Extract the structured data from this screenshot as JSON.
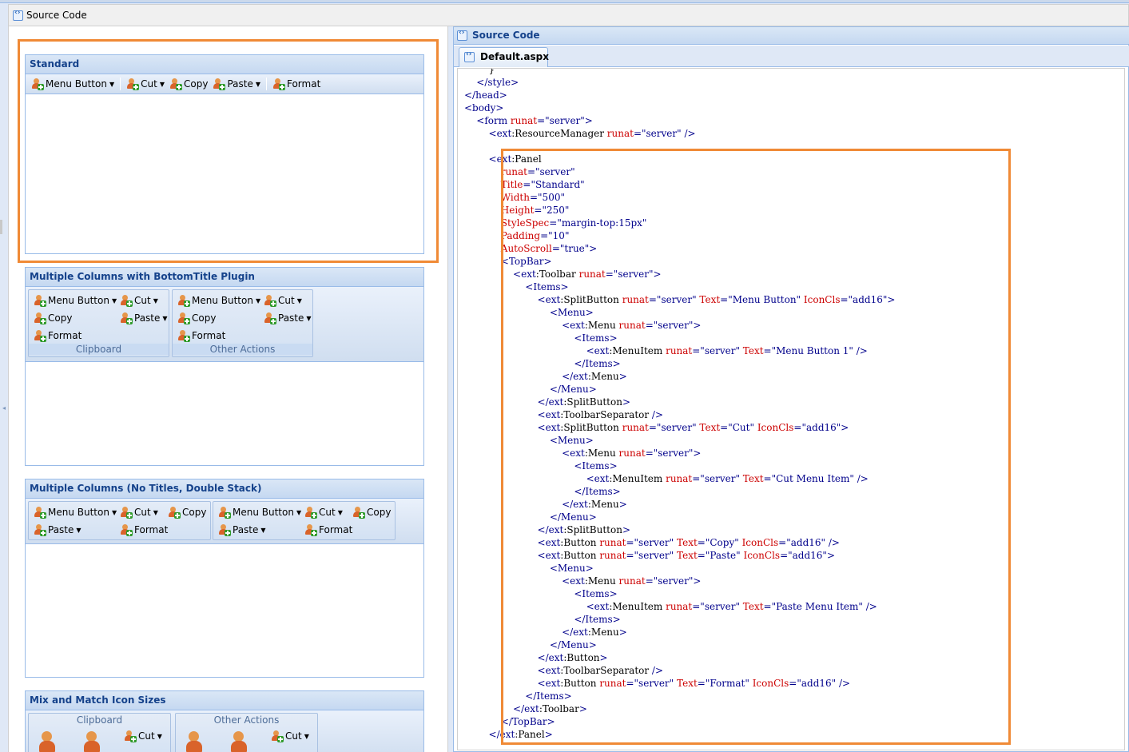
{
  "left_header": {
    "title": "Source Code"
  },
  "right_header": {
    "title": "Source Code"
  },
  "file_tab": {
    "label": "Default.aspx"
  },
  "colors": {
    "highlight": "#f08a36",
    "panel_title": "#15428b",
    "code_tag": "#00008b",
    "code_attr": "#c00000"
  },
  "icons": {
    "toolbar_button": "user-add-icon",
    "source": "code-file-icon"
  },
  "panels": {
    "standard": {
      "title": "Standard",
      "buttons": [
        "Menu Button",
        "Cut",
        "Copy",
        "Paste",
        "Format"
      ]
    },
    "multi_bottom": {
      "title": "Multiple Columns with BottomTitle Plugin",
      "group1": {
        "title": "Clipboard",
        "items": [
          "Menu Button",
          "Cut",
          "Copy",
          "Paste",
          "Format"
        ]
      },
      "group2": {
        "title": "Other Actions",
        "items": [
          "Menu Button",
          "Cut",
          "Copy",
          "Paste",
          "Format"
        ]
      }
    },
    "multi_notitle": {
      "title": "Multiple Columns (No Titles, Double Stack)",
      "group1": {
        "items": [
          "Menu Button",
          "Cut",
          "Copy",
          "Paste",
          "Format"
        ]
      },
      "group2": {
        "items": [
          "Menu Button",
          "Cut",
          "Copy",
          "Paste",
          "Format"
        ]
      }
    },
    "mix": {
      "title": "Mix and Match Icon Sizes",
      "group1": {
        "title": "Clipboard",
        "items": [
          "Cut"
        ]
      },
      "group2": {
        "title": "Other Actions",
        "items": [
          "Cut"
        ]
      }
    }
  },
  "code_lines": [
    [
      {
        "t": "        }"
      }
    ],
    [
      {
        "t": "    "
      },
      {
        "c": "tag",
        "t": "</style>"
      }
    ],
    [
      {
        "c": "tag",
        "t": "</head>"
      }
    ],
    [
      {
        "c": "tag",
        "t": "<body>"
      }
    ],
    [
      {
        "t": "    "
      },
      {
        "c": "tag",
        "t": "<form "
      },
      {
        "c": "attr",
        "t": "runat"
      },
      {
        "c": "tag",
        "t": "=\"server\">"
      }
    ],
    [
      {
        "t": "        "
      },
      {
        "c": "tag",
        "t": "<ext"
      },
      {
        "t": ":ResourceManager "
      },
      {
        "c": "attr",
        "t": "runat"
      },
      {
        "c": "tag",
        "t": "=\"server\" />"
      }
    ],
    [
      {
        "t": ""
      }
    ],
    [
      {
        "t": "        "
      },
      {
        "c": "tag",
        "t": "<ext"
      },
      {
        "t": ":Panel"
      }
    ],
    [
      {
        "t": "            "
      },
      {
        "c": "attr",
        "t": "runat"
      },
      {
        "c": "tag",
        "t": "=\"server\""
      }
    ],
    [
      {
        "t": "            "
      },
      {
        "c": "attr",
        "t": "Title"
      },
      {
        "c": "tag",
        "t": "=\"Standard\""
      }
    ],
    [
      {
        "t": "            "
      },
      {
        "c": "attr",
        "t": "Width"
      },
      {
        "c": "tag",
        "t": "=\"500\""
      }
    ],
    [
      {
        "t": "            "
      },
      {
        "c": "attr",
        "t": "Height"
      },
      {
        "c": "tag",
        "t": "=\"250\""
      }
    ],
    [
      {
        "t": "            "
      },
      {
        "c": "attr",
        "t": "StyleSpec"
      },
      {
        "c": "tag",
        "t": "=\"margin-top:15px\""
      }
    ],
    [
      {
        "t": "            "
      },
      {
        "c": "attr",
        "t": "Padding"
      },
      {
        "c": "tag",
        "t": "=\"10\""
      }
    ],
    [
      {
        "t": "            "
      },
      {
        "c": "attr",
        "t": "AutoScroll"
      },
      {
        "c": "tag",
        "t": "=\"true\">"
      }
    ],
    [
      {
        "t": "            "
      },
      {
        "c": "tag",
        "t": "<TopBar>"
      }
    ],
    [
      {
        "t": "                "
      },
      {
        "c": "tag",
        "t": "<ext"
      },
      {
        "t": ":Toolbar "
      },
      {
        "c": "attr",
        "t": "runat"
      },
      {
        "c": "tag",
        "t": "=\"server\">"
      }
    ],
    [
      {
        "t": "                    "
      },
      {
        "c": "tag",
        "t": "<Items>"
      }
    ],
    [
      {
        "t": "                        "
      },
      {
        "c": "tag",
        "t": "<ext"
      },
      {
        "t": ":SplitButton "
      },
      {
        "c": "attr",
        "t": "runat"
      },
      {
        "c": "tag",
        "t": "=\"server\" "
      },
      {
        "c": "attr",
        "t": "Text"
      },
      {
        "c": "tag",
        "t": "=\"Menu Button\" "
      },
      {
        "c": "attr",
        "t": "IconCls"
      },
      {
        "c": "tag",
        "t": "=\"add16\">"
      }
    ],
    [
      {
        "t": "                            "
      },
      {
        "c": "tag",
        "t": "<Menu>"
      }
    ],
    [
      {
        "t": "                                "
      },
      {
        "c": "tag",
        "t": "<ext"
      },
      {
        "t": ":Menu "
      },
      {
        "c": "attr",
        "t": "runat"
      },
      {
        "c": "tag",
        "t": "=\"server\">"
      }
    ],
    [
      {
        "t": "                                    "
      },
      {
        "c": "tag",
        "t": "<Items>"
      }
    ],
    [
      {
        "t": "                                        "
      },
      {
        "c": "tag",
        "t": "<ext"
      },
      {
        "t": ":MenuItem "
      },
      {
        "c": "attr",
        "t": "runat"
      },
      {
        "c": "tag",
        "t": "=\"server\" "
      },
      {
        "c": "attr",
        "t": "Text"
      },
      {
        "c": "tag",
        "t": "=\"Menu Button 1\" />"
      }
    ],
    [
      {
        "t": "                                    "
      },
      {
        "c": "tag",
        "t": "</Items>"
      }
    ],
    [
      {
        "t": "                                "
      },
      {
        "c": "tag",
        "t": "</ext"
      },
      {
        "t": ":Menu"
      },
      {
        "c": "tag",
        "t": ">"
      }
    ],
    [
      {
        "t": "                            "
      },
      {
        "c": "tag",
        "t": "</Menu>"
      }
    ],
    [
      {
        "t": "                        "
      },
      {
        "c": "tag",
        "t": "</ext"
      },
      {
        "t": ":SplitButton"
      },
      {
        "c": "tag",
        "t": ">"
      }
    ],
    [
      {
        "t": "                        "
      },
      {
        "c": "tag",
        "t": "<ext"
      },
      {
        "t": ":ToolbarSeparator "
      },
      {
        "c": "tag",
        "t": "/>"
      }
    ],
    [
      {
        "t": "                        "
      },
      {
        "c": "tag",
        "t": "<ext"
      },
      {
        "t": ":SplitButton "
      },
      {
        "c": "attr",
        "t": "runat"
      },
      {
        "c": "tag",
        "t": "=\"server\" "
      },
      {
        "c": "attr",
        "t": "Text"
      },
      {
        "c": "tag",
        "t": "=\"Cut\" "
      },
      {
        "c": "attr",
        "t": "IconCls"
      },
      {
        "c": "tag",
        "t": "=\"add16\">"
      }
    ],
    [
      {
        "t": "                            "
      },
      {
        "c": "tag",
        "t": "<Menu>"
      }
    ],
    [
      {
        "t": "                                "
      },
      {
        "c": "tag",
        "t": "<ext"
      },
      {
        "t": ":Menu "
      },
      {
        "c": "attr",
        "t": "runat"
      },
      {
        "c": "tag",
        "t": "=\"server\">"
      }
    ],
    [
      {
        "t": "                                    "
      },
      {
        "c": "tag",
        "t": "<Items>"
      }
    ],
    [
      {
        "t": "                                        "
      },
      {
        "c": "tag",
        "t": "<ext"
      },
      {
        "t": ":MenuItem "
      },
      {
        "c": "attr",
        "t": "runat"
      },
      {
        "c": "tag",
        "t": "=\"server\" "
      },
      {
        "c": "attr",
        "t": "Text"
      },
      {
        "c": "tag",
        "t": "=\"Cut Menu Item\" />"
      }
    ],
    [
      {
        "t": "                                    "
      },
      {
        "c": "tag",
        "t": "</Items>"
      }
    ],
    [
      {
        "t": "                                "
      },
      {
        "c": "tag",
        "t": "</ext"
      },
      {
        "t": ":Menu"
      },
      {
        "c": "tag",
        "t": ">"
      }
    ],
    [
      {
        "t": "                            "
      },
      {
        "c": "tag",
        "t": "</Menu>"
      }
    ],
    [
      {
        "t": "                        "
      },
      {
        "c": "tag",
        "t": "</ext"
      },
      {
        "t": ":SplitButton"
      },
      {
        "c": "tag",
        "t": ">"
      }
    ],
    [
      {
        "t": "                        "
      },
      {
        "c": "tag",
        "t": "<ext"
      },
      {
        "t": ":Button "
      },
      {
        "c": "attr",
        "t": "runat"
      },
      {
        "c": "tag",
        "t": "=\"server\" "
      },
      {
        "c": "attr",
        "t": "Text"
      },
      {
        "c": "tag",
        "t": "=\"Copy\" "
      },
      {
        "c": "attr",
        "t": "IconCls"
      },
      {
        "c": "tag",
        "t": "=\"add16\" />"
      }
    ],
    [
      {
        "t": "                        "
      },
      {
        "c": "tag",
        "t": "<ext"
      },
      {
        "t": ":Button "
      },
      {
        "c": "attr",
        "t": "runat"
      },
      {
        "c": "tag",
        "t": "=\"server\" "
      },
      {
        "c": "attr",
        "t": "Text"
      },
      {
        "c": "tag",
        "t": "=\"Paste\" "
      },
      {
        "c": "attr",
        "t": "IconCls"
      },
      {
        "c": "tag",
        "t": "=\"add16\">"
      }
    ],
    [
      {
        "t": "                            "
      },
      {
        "c": "tag",
        "t": "<Menu>"
      }
    ],
    [
      {
        "t": "                                "
      },
      {
        "c": "tag",
        "t": "<ext"
      },
      {
        "t": ":Menu "
      },
      {
        "c": "attr",
        "t": "runat"
      },
      {
        "c": "tag",
        "t": "=\"server\">"
      }
    ],
    [
      {
        "t": "                                    "
      },
      {
        "c": "tag",
        "t": "<Items>"
      }
    ],
    [
      {
        "t": "                                        "
      },
      {
        "c": "tag",
        "t": "<ext"
      },
      {
        "t": ":MenuItem "
      },
      {
        "c": "attr",
        "t": "runat"
      },
      {
        "c": "tag",
        "t": "=\"server\" "
      },
      {
        "c": "attr",
        "t": "Text"
      },
      {
        "c": "tag",
        "t": "=\"Paste Menu Item\" />"
      }
    ],
    [
      {
        "t": "                                    "
      },
      {
        "c": "tag",
        "t": "</Items>"
      }
    ],
    [
      {
        "t": "                                "
      },
      {
        "c": "tag",
        "t": "</ext"
      },
      {
        "t": ":Menu"
      },
      {
        "c": "tag",
        "t": ">"
      }
    ],
    [
      {
        "t": "                            "
      },
      {
        "c": "tag",
        "t": "</Menu>"
      }
    ],
    [
      {
        "t": "                        "
      },
      {
        "c": "tag",
        "t": "</ext"
      },
      {
        "t": ":Button"
      },
      {
        "c": "tag",
        "t": ">"
      }
    ],
    [
      {
        "t": "                        "
      },
      {
        "c": "tag",
        "t": "<ext"
      },
      {
        "t": ":ToolbarSeparator "
      },
      {
        "c": "tag",
        "t": "/>"
      }
    ],
    [
      {
        "t": "                        "
      },
      {
        "c": "tag",
        "t": "<ext"
      },
      {
        "t": ":Button "
      },
      {
        "c": "attr",
        "t": "runat"
      },
      {
        "c": "tag",
        "t": "=\"server\" "
      },
      {
        "c": "attr",
        "t": "Text"
      },
      {
        "c": "tag",
        "t": "=\"Format\" "
      },
      {
        "c": "attr",
        "t": "IconCls"
      },
      {
        "c": "tag",
        "t": "=\"add16\" />"
      }
    ],
    [
      {
        "t": "                    "
      },
      {
        "c": "tag",
        "t": "</Items>"
      }
    ],
    [
      {
        "t": "                "
      },
      {
        "c": "tag",
        "t": "</ext"
      },
      {
        "t": ":Toolbar"
      },
      {
        "c": "tag",
        "t": ">"
      }
    ],
    [
      {
        "t": "            "
      },
      {
        "c": "tag",
        "t": "</TopBar>"
      }
    ],
    [
      {
        "t": "        "
      },
      {
        "c": "tag",
        "t": "</ext"
      },
      {
        "t": ":Panel"
      },
      {
        "c": "tag",
        "t": ">"
      }
    ]
  ]
}
